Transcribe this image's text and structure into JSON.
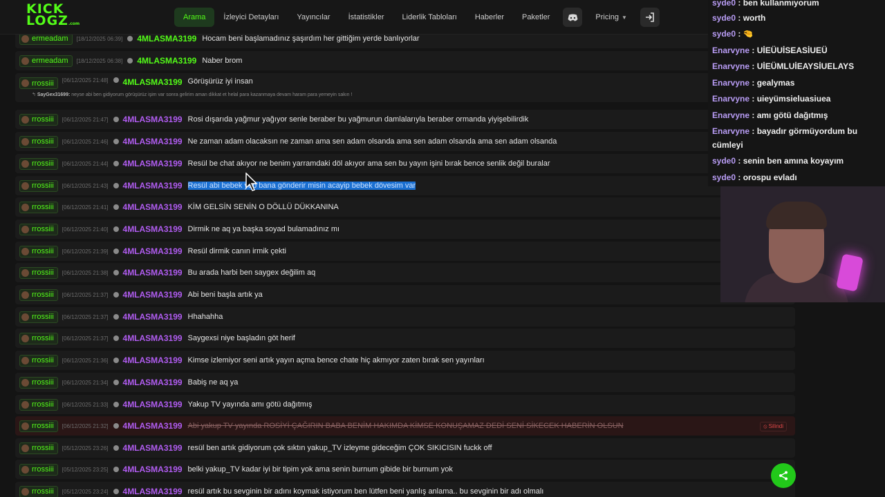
{
  "header": {
    "logo_line1": "KICK",
    "logo_line2": "LOGZ",
    "logo_suffix": ".com",
    "nav": [
      {
        "label": "Arama",
        "active": true
      },
      {
        "label": "İzleyici Detayları"
      },
      {
        "label": "Yayıncılar"
      },
      {
        "label": "İstatistikler"
      },
      {
        "label": "Liderlik Tabloları"
      },
      {
        "label": "Haberler"
      },
      {
        "label": "Paketler"
      }
    ],
    "discord_icon": "discord-icon",
    "pricing_label": "Pricing",
    "login_icon": "login-icon"
  },
  "messages": [
    {
      "user": "ermeadam",
      "ts": "[18/12/2025 06:39]",
      "author": "4MLASMA3199",
      "author_color": "#53fc18",
      "text": "Hocam beni başlamadınız şaşırdım her gittiğim yerde banlıyorlar"
    },
    {
      "user": "ermeadam",
      "ts": "[18/12/2025 06:38]",
      "author": "4MLASMA3199",
      "author_color": "#53fc18",
      "text": "Naber brom"
    },
    {
      "user": "rrossiii",
      "ts": "[06/12/2025 21:48]",
      "author": "4MLASMA3199",
      "author_color": "#53fc18",
      "text": "Görüşürüz iyi insan",
      "reply_user": "SayGex31699:",
      "reply_text": "neyse abi ben gidiyorum görüşürüz işim var sonra gelirim aman dikkat et helal para kazanmaya devam haram para yemeyin sakın !"
    },
    {
      "user": "rrossiii",
      "ts": "[06/12/2025 21:47]",
      "author": "4MLASMA3199",
      "text": "Rosi dışarıda yağmur yağıyor senle beraber bu yağmurun damlalarıyla beraber ormanda yiyişebilirdik"
    },
    {
      "user": "rrossiii",
      "ts": "[06/12/2025 21:46]",
      "author": "4MLASMA3199",
      "text": "Ne zaman adam olacaksın ne zaman ama sen adam olsanda ama sen adam olsanda ama sen adam olsanda"
    },
    {
      "user": "rrossiii",
      "ts": "[06/12/2025 21:44]",
      "author": "4MLASMA3199",
      "text": "Resül be chat akıyor ne benim yarramdaki döl akıyor ama sen bu yayın işini bırak bence senlik değil buralar"
    },
    {
      "user": "rrossiii",
      "ts": "[06/12/2025 21:43]",
      "author": "4MLASMA3199",
      "text": "Resül abi bebek yap bana gönderir misin acayip bebek dövesim var",
      "selected": true
    },
    {
      "user": "rrossiii",
      "ts": "[06/12/2025 21:41]",
      "author": "4MLASMA3199",
      "text": "KİM GELSİN SENİN O DÖLLÜ DÜKKANINA"
    },
    {
      "user": "rrossiii",
      "ts": "[06/12/2025 21:40]",
      "author": "4MLASMA3199",
      "text": "Dirmik ne aq ya başka soyad bulamadınız mı"
    },
    {
      "user": "rrossiii",
      "ts": "[06/12/2025 21:39]",
      "author": "4MLASMA3199",
      "text": "Resül dirmik canın irmik çekti"
    },
    {
      "user": "rrossiii",
      "ts": "[06/12/2025 21:38]",
      "author": "4MLASMA3199",
      "text": "Bu arada harbi ben saygex değilim aq"
    },
    {
      "user": "rrossiii",
      "ts": "[06/12/2025 21:37]",
      "author": "4MLASMA3199",
      "text": "Abi beni başla artık ya"
    },
    {
      "user": "rrossiii",
      "ts": "[06/12/2025 21:37]",
      "author": "4MLASMA3199",
      "text": "Hhahahha"
    },
    {
      "user": "rrossiii",
      "ts": "[06/12/2025 21:37]",
      "author": "4MLASMA3199",
      "text": "Saygexsi niye başladın göt herif"
    },
    {
      "user": "rrossiii",
      "ts": "[06/12/2025 21:36]",
      "author": "4MLASMA3199",
      "text": "Kimse izlemiyor seni artık yayın açma bence chate hiç akmıyor zaten bırak sen yayınları"
    },
    {
      "user": "rrossiii",
      "ts": "[06/12/2025 21:34]",
      "author": "4MLASMA3199",
      "text": "Babiş ne aq ya"
    },
    {
      "user": "rrossiii",
      "ts": "[06/12/2025 21:33]",
      "author": "4MLASMA3199",
      "text": "Yakup TV yayında amı götü dağıtmış"
    },
    {
      "user": "rrossiii",
      "ts": "[06/12/2025 21:32]",
      "author": "4MLASMA3199",
      "text": "Abi yakup TV yayında ROSİYİ ÇAĞIRIN BABA BENİM HAKIMDA KİMSE KONUŞAMAZ DEDİ SENİ SİKECEK HABERİN OLSUN",
      "deleted": true,
      "deleted_label": "Silindi"
    },
    {
      "user": "rrossiii",
      "ts": "[05/12/2025 23:26]",
      "author": "4MLASMA3199",
      "text": "resül ben artık gidiyorum çok sıktın yakup_TV izleyme gideceğim ÇOK SIKICISIN fuckk off"
    },
    {
      "user": "rrossiii",
      "ts": "[05/12/2025 23:25]",
      "author": "4MLASMA3199",
      "text": "belki yakup_TV kadar iyi bir tipim yok ama senin burnum gibide bir burnum yok"
    },
    {
      "user": "rrossiii",
      "ts": "[05/12/2025 23:24]",
      "author": "4MLASMA3199",
      "text": "resül artık bu sevginin bir adını koymak istiyorum ben lütfen beni yanlış anlama.. bu sevginin bir adı olmalı"
    }
  ],
  "stream_chat": [
    {
      "user": "syde0",
      "text": "ben kullanmıyorum"
    },
    {
      "user": "syde0",
      "text": "worth"
    },
    {
      "user": "syde0",
      "text": "🤏"
    },
    {
      "user": "Enarvyne",
      "text": "UİEÜUİSEASİUEÜ"
    },
    {
      "user": "Enarvyne",
      "text": "UİEÜMLUİEAYSİUELAYS"
    },
    {
      "user": "Enarvyne",
      "text": "gealymas"
    },
    {
      "user": "Enarvyne",
      "text": "uieyümsieluasiuea"
    },
    {
      "user": "Enarvyne",
      "text": "amı götü dağıtmış"
    },
    {
      "user": "Enarvyne",
      "text": "bayadır görmüyordum bu cümleyi"
    },
    {
      "user": "syde0",
      "text": "senin ben amına koyayım"
    },
    {
      "user": "syde0",
      "text": "orospu evladı"
    }
  ],
  "share_icon": "share-icon"
}
